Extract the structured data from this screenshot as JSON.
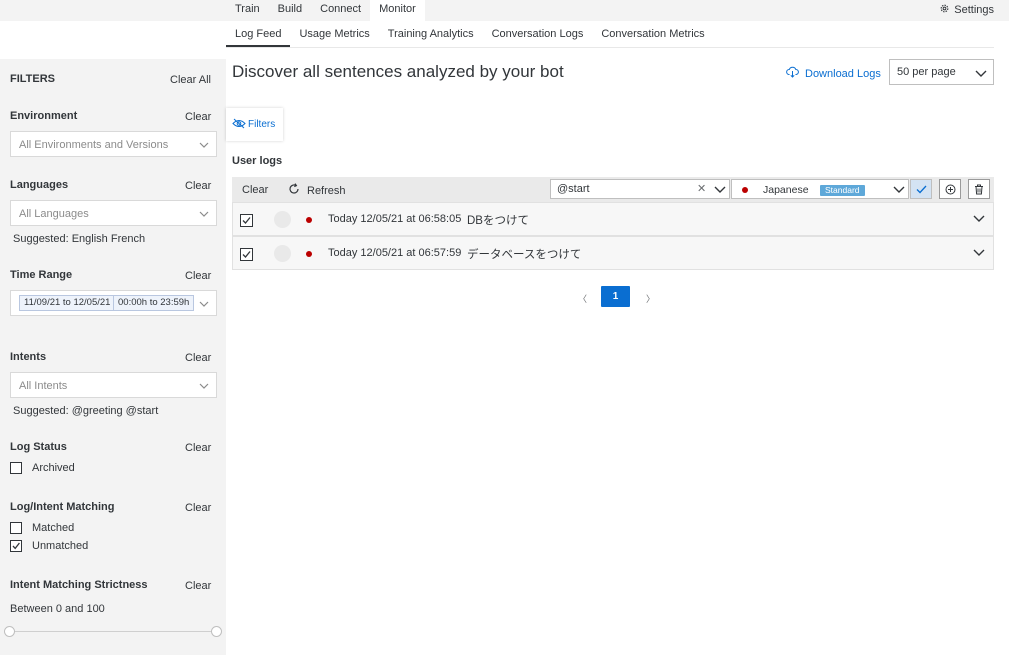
{
  "top_nav": {
    "tabs": [
      "Train",
      "Build",
      "Connect",
      "Monitor"
    ],
    "active": "Monitor",
    "settings_label": "Settings"
  },
  "sub_nav": {
    "tabs": [
      "Log Feed",
      "Usage Metrics",
      "Training Analytics",
      "Conversation Logs",
      "Conversation Metrics"
    ],
    "active": "Log Feed"
  },
  "sidebar": {
    "title": "FILTERS",
    "clear_all": "Clear All",
    "clear": "Clear",
    "environment": {
      "label": "Environment",
      "placeholder": "All Environments and Versions"
    },
    "languages": {
      "label": "Languages",
      "placeholder": "All Languages",
      "suggested": "Suggested: English French"
    },
    "time_range": {
      "label": "Time Range",
      "date_token": "11/09/21 to 12/05/21",
      "time_token": "00:00h to 23:59h"
    },
    "intents": {
      "label": "Intents",
      "placeholder": "All Intents",
      "suggested": "Suggested: @greeting @start"
    },
    "log_status": {
      "label": "Log Status",
      "options": [
        {
          "label": "Archived",
          "checked": false
        }
      ]
    },
    "log_intent_matching": {
      "label": "Log/Intent Matching",
      "options": [
        {
          "label": "Matched",
          "checked": false
        },
        {
          "label": "Unmatched",
          "checked": true
        }
      ]
    },
    "strictness": {
      "label": "Intent Matching Strictness",
      "range_text": "Between 0 and 100",
      "min": 0,
      "max": 100
    }
  },
  "main": {
    "title": "Discover all sentences analyzed by your bot",
    "download_label": "Download Logs",
    "per_page": "50 per page",
    "filters_button": "Filters",
    "section_title": "User logs",
    "toolbar": {
      "clear": "Clear",
      "refresh": "Refresh",
      "intent_value": "@start",
      "language": "Japanese",
      "language_badge": "Standard"
    },
    "logs": [
      {
        "checked": true,
        "time": "Today 12/05/21 at 06:58:05",
        "text": "DBをつけて"
      },
      {
        "checked": true,
        "time": "Today 12/05/21 at 06:57:59",
        "text": "データベースをつけて"
      }
    ],
    "pagination": {
      "current": "1"
    }
  },
  "colors": {
    "accent": "#0a6ed1",
    "status_red": "#bb0000",
    "badge": "#5ea8d9"
  }
}
